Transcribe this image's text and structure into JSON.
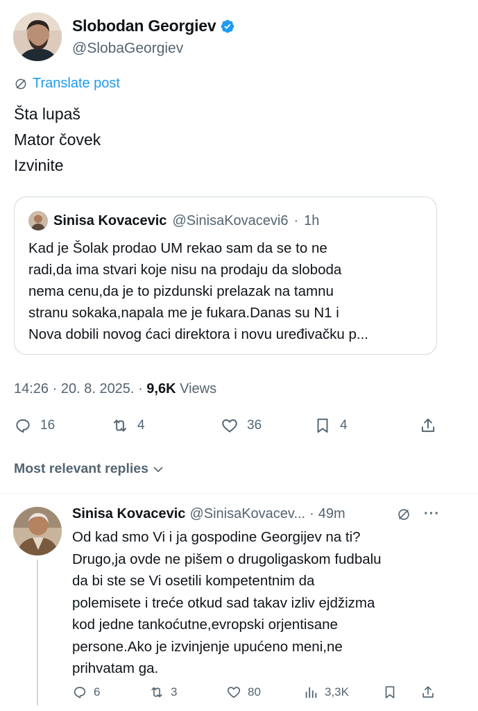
{
  "post": {
    "author_name": "Slobodan Georgiev",
    "author_handle": "@SlobaGeorgiev",
    "translate_label": "Translate post",
    "lines": [
      "Šta lupaš",
      "Mator čovek",
      "Izvinite"
    ]
  },
  "quote": {
    "author_name": "Sinisa Kovacevic",
    "author_handle": "@SinisaKovacevi6",
    "separator": "·",
    "time": "1h",
    "lines": [
      "Kad je Šolak prodao UM rekao sam da se to ne",
      "radi,da ima stvari koje nisu na prodaju da sloboda",
      "nema cenu,da je to pizdunski prelazak na tamnu",
      "stranu sokaka,napala me je fukara.Danas su N1 i",
      "Nova dobili novog ćaci direktora i novu uređivačku p..."
    ]
  },
  "meta": {
    "time": "14:26",
    "date": "20. 8. 2025.",
    "views_count": "9,6K",
    "views_label": "Views"
  },
  "actions": {
    "replies": "16",
    "reposts": "4",
    "likes": "36",
    "bookmarks": "4"
  },
  "most_relevant_label": "Most relevant replies",
  "reply": {
    "author_name": "Sinisa Kovacevic",
    "author_handle": "@SinisaKovacev...",
    "separator": "·",
    "time": "49m",
    "more": "···",
    "lines": [
      "Od kad smo Vi i ja gospodine Georgijev na ti?",
      "Drugo,ja ovde ne pišem o drugoligaskom fudbalu",
      "da bi ste se Vi osetili kompetentnim da",
      "polemisete i treće otkud sad takav izliv ejdžizma",
      "kod jedne tankoćutne,evropski orjentisane",
      "persone.Ako je izvinjenje upućeno meni,ne",
      "prihvatam ga."
    ],
    "actions": {
      "replies": "6",
      "reposts": "3",
      "likes": "80",
      "views": "3,3K"
    }
  },
  "colors": {
    "accent": "#1d9bf0",
    "text": "#0f1419",
    "secondary": "#536471",
    "border": "#cfd9de"
  },
  "icons": [
    "verified-badge-icon",
    "translate-icon",
    "reply-icon",
    "repost-icon",
    "like-icon",
    "bookmark-icon",
    "share-icon",
    "chevron-down-icon",
    "grok-icon",
    "more-icon",
    "views-icon"
  ]
}
